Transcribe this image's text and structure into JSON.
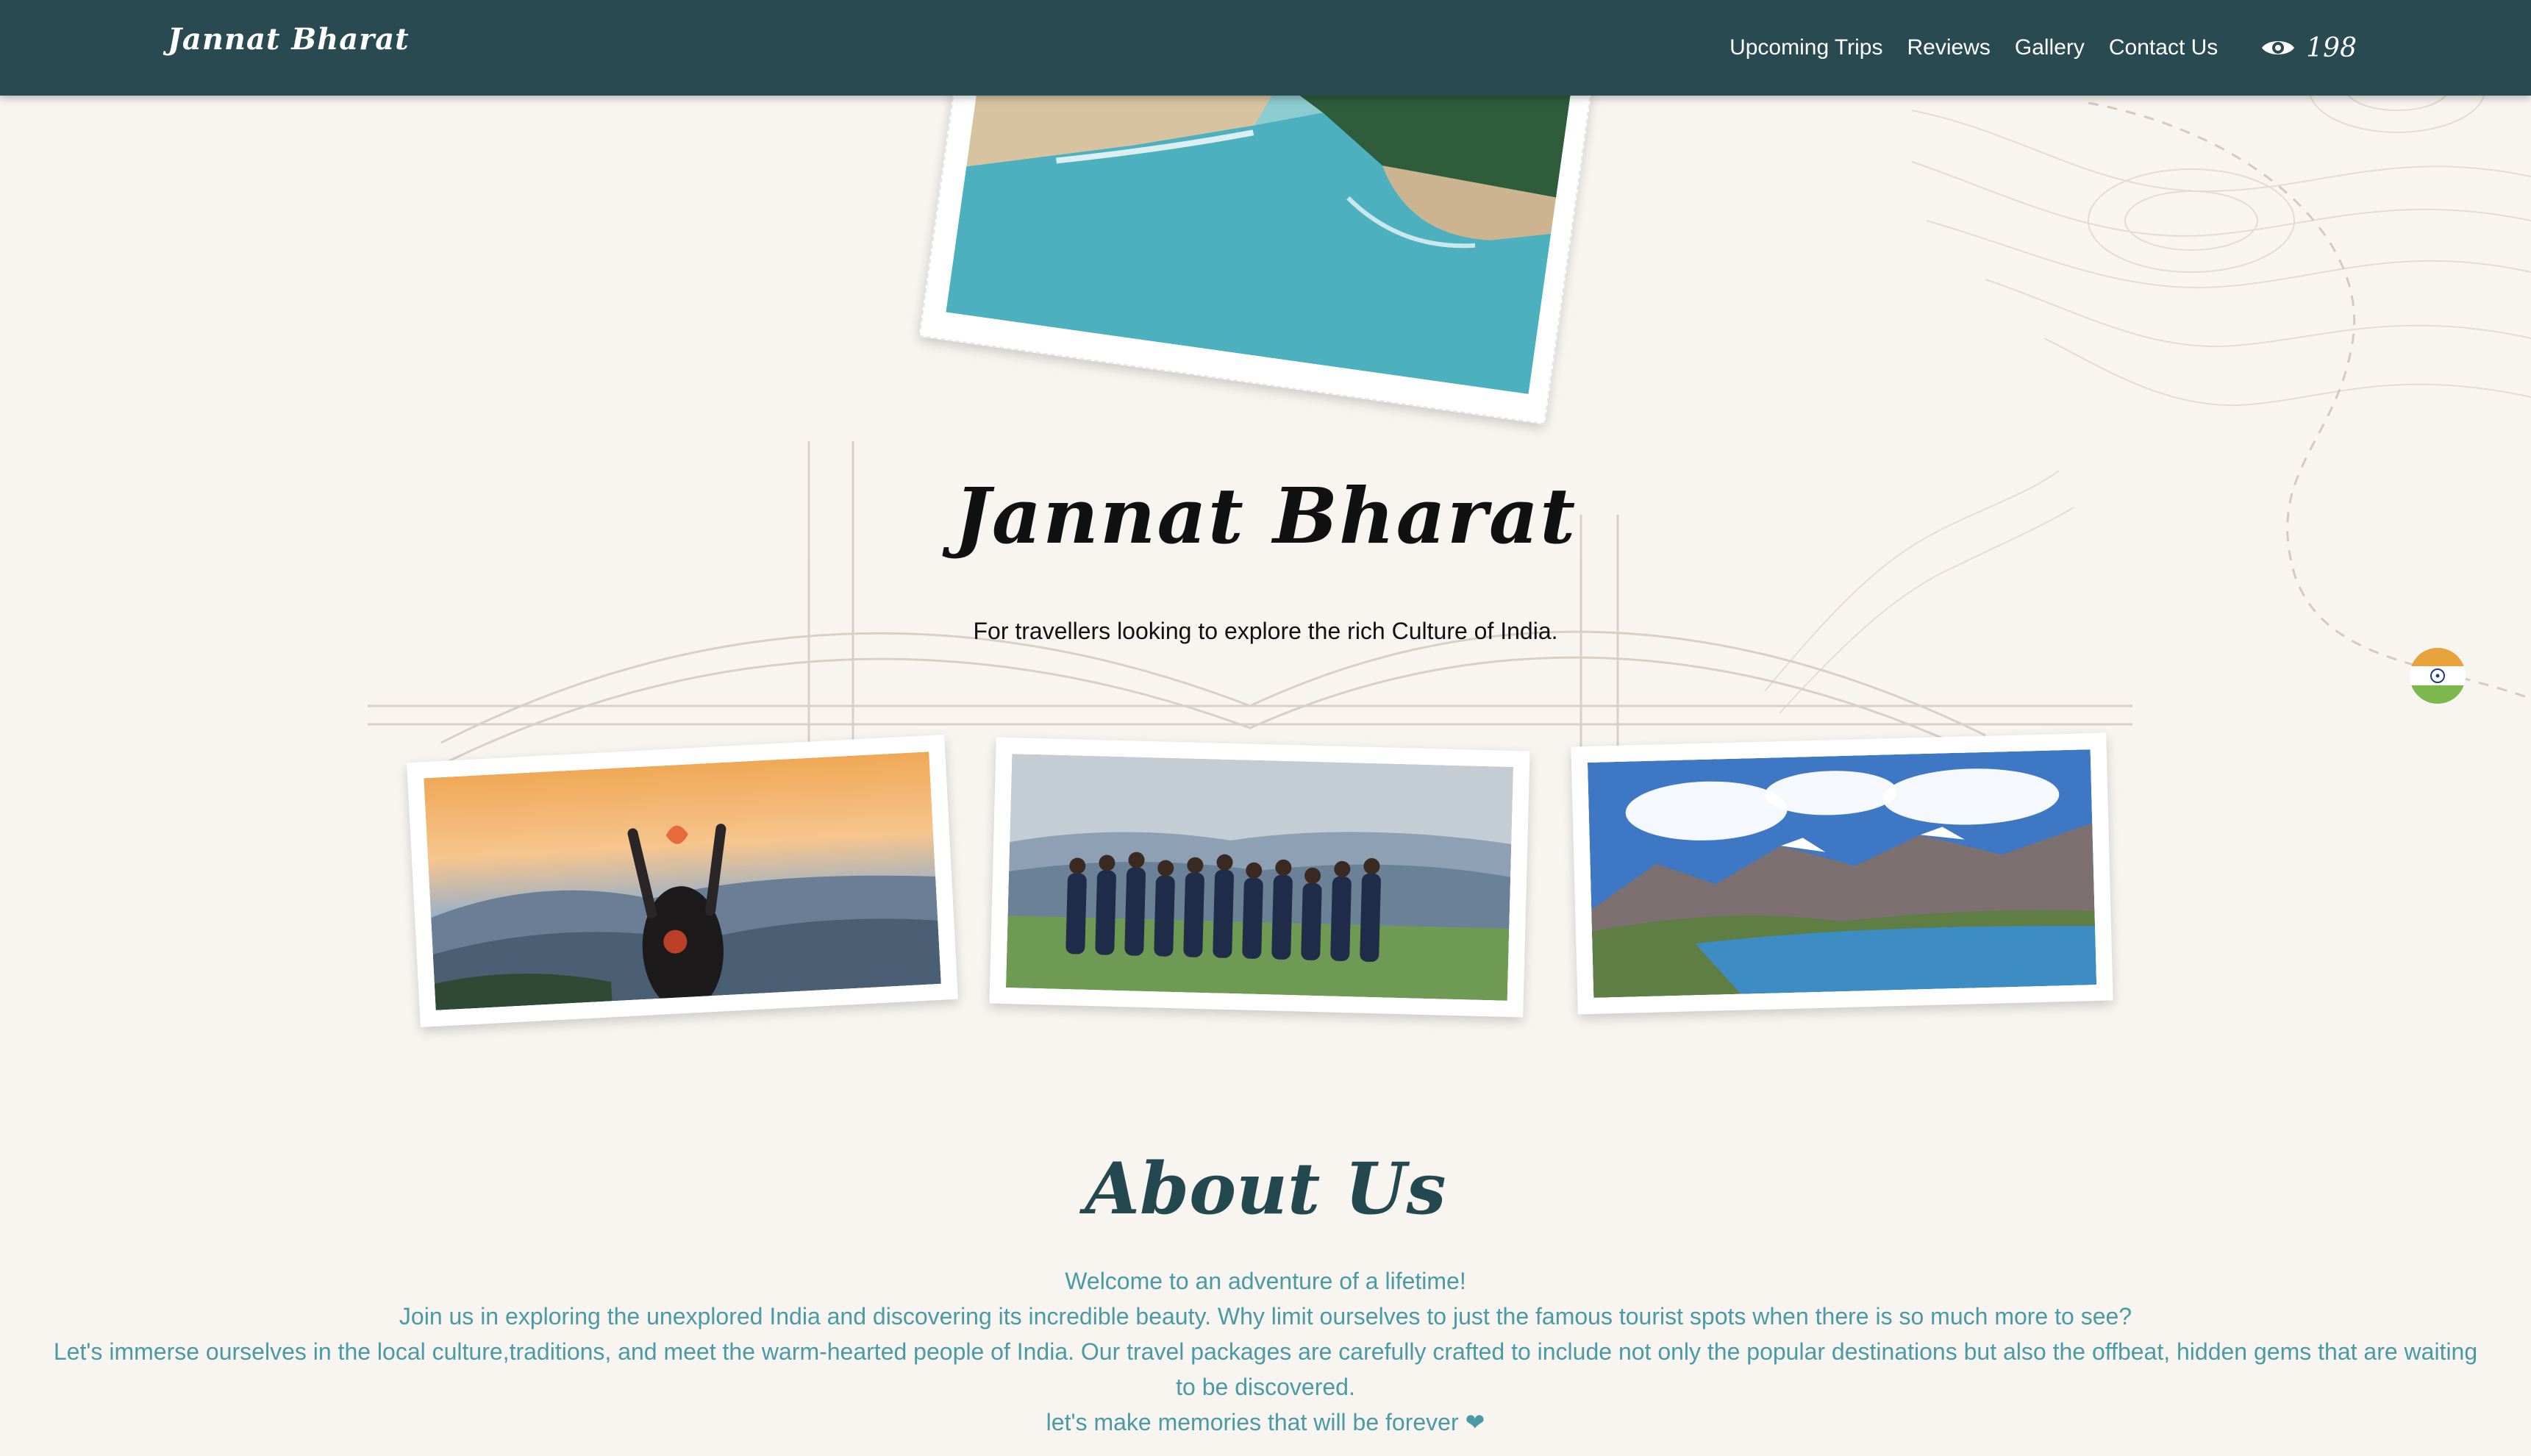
{
  "nav": {
    "brand": "Jannat Bharat",
    "links": [
      "Upcoming Trips",
      "Reviews",
      "Gallery",
      "Contact Us"
    ],
    "view_count": "198"
  },
  "hero": {
    "title": "Jannat Bharat",
    "subtitle": "For travellers looking to explore the rich Culture of India."
  },
  "about": {
    "title": "About Us",
    "paragraphs": [
      "Welcome to an adventure of a lifetime!",
      "Join us in exploring the unexplored India and discovering its incredible beauty. Why limit ourselves to just the famous tourist spots when there is so much more to see?",
      "Let's immerse ourselves in the local culture,traditions, and meet the warm-hearted people of India. Our travel packages are carefully crafted to include not only the popular destinations but also the offbeat, hidden gems that are waiting to be discovered.",
      "let's make memories that will be forever ❤"
    ]
  },
  "colors": {
    "nav_bg": "#284a50",
    "page_bg": "#f8f5f1",
    "accent": "#24484f",
    "about_text": "#4a9aa6"
  },
  "icons": {
    "views": "eye-icon",
    "flag": "india-flag-icon"
  },
  "images": {
    "hero": "beach-aerial-photo",
    "gallery": [
      "sunset-heart-photo",
      "group-photo",
      "mountain-lake-photo"
    ]
  }
}
